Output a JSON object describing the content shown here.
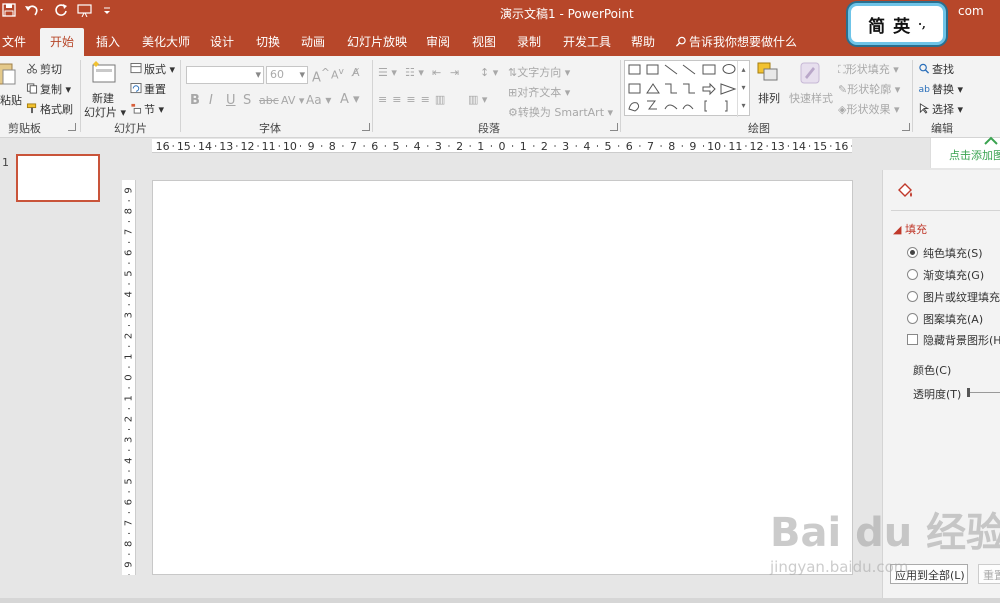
{
  "title_bar": {
    "document_title": "演示文稿1  -  PowerPoint",
    "domain_suffix": "com",
    "accent_color": "#b7472a"
  },
  "ime": {
    "mode": "简",
    "lang": "英",
    "punct": "·,"
  },
  "tabs": [
    {
      "label": "文件"
    },
    {
      "label": "开始",
      "active": true
    },
    {
      "label": "插入"
    },
    {
      "label": "美化大师"
    },
    {
      "label": "设计"
    },
    {
      "label": "切换"
    },
    {
      "label": "动画"
    },
    {
      "label": "幻灯片放映"
    },
    {
      "label": "审阅"
    },
    {
      "label": "视图"
    },
    {
      "label": "录制"
    },
    {
      "label": "开发工具"
    },
    {
      "label": "帮助"
    }
  ],
  "tell_me": "告诉我你想要做什么",
  "ribbon": {
    "clipboard": {
      "label": "剪贴板",
      "paste": "粘贴",
      "cut": "剪切",
      "copy": "复制",
      "format_painter": "格式刷"
    },
    "slides": {
      "label": "幻灯片",
      "new_slide": "新建",
      "new_slide_2": "幻灯片",
      "layout": "版式",
      "reset": "重置",
      "section": "节"
    },
    "font": {
      "label": "字体",
      "font_size": "60"
    },
    "paragraph": {
      "label": "段落",
      "text_direction": "文字方向",
      "align_text": "对齐文本",
      "convert_smartart": "转换为 SmartArt"
    },
    "drawing": {
      "label": "绘图",
      "arrange": "排列",
      "quick_styles": "快速样式",
      "shape_fill": "形状填充",
      "shape_outline": "形状轮廓",
      "shape_effects": "形状效果"
    },
    "editing": {
      "label": "编辑",
      "find": "查找",
      "replace": "替换",
      "select": "选择"
    }
  },
  "slide_pane": {
    "slide_number": "1"
  },
  "rulers": {
    "horizontal": [
      "16",
      "15",
      "14",
      "13",
      "12",
      "11",
      "10",
      "9",
      "8",
      "7",
      "6",
      "5",
      "4",
      "3",
      "2",
      "1",
      "0",
      "1",
      "2",
      "3",
      "4",
      "5",
      "6",
      "7",
      "8",
      "9",
      "10",
      "11",
      "12",
      "13",
      "14",
      "15",
      "16"
    ],
    "vertical": [
      "9",
      "8",
      "7",
      "6",
      "5",
      "4",
      "3",
      "2",
      "1",
      "0",
      "1",
      "2",
      "3",
      "4",
      "5",
      "6",
      "7",
      "8",
      "9"
    ]
  },
  "format_panel": {
    "add_button": "点击添加图",
    "section_title": "填充",
    "options": [
      {
        "label": "纯色填充(S)",
        "selected": true
      },
      {
        "label": "渐变填充(G)",
        "selected": false
      },
      {
        "label": "图片或纹理填充",
        "selected": false
      },
      {
        "label": "图案填充(A)",
        "selected": false
      }
    ],
    "hide_bg": "隐藏背景图形(H",
    "color_label": "颜色(C)",
    "transparency_label": "透明度(T)",
    "apply_all": "应用到全部(L)",
    "reset": "重置"
  },
  "watermark": {
    "text": "Bai du 经验",
    "sub": "jingyan.baidu.com"
  }
}
